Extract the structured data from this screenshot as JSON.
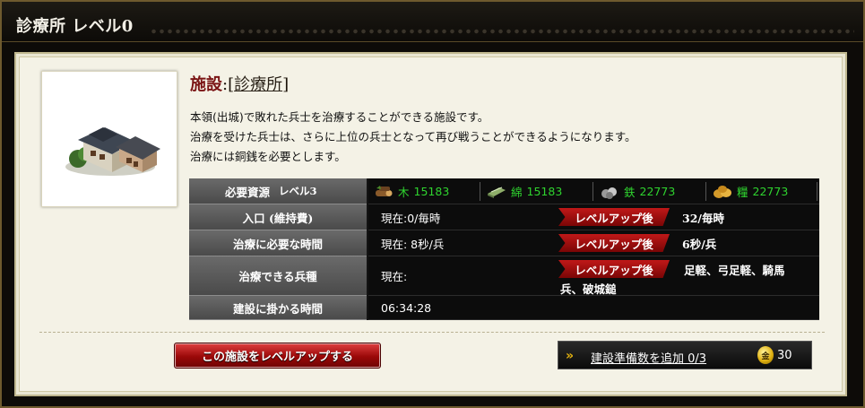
{
  "header": {
    "title": "診療所 レベル0"
  },
  "facility": {
    "label": "施設",
    "colon_open": ":[",
    "name": "診療所",
    "close": "]",
    "description": [
      "本領(出城)で敗れた兵士を治療することができる施設です。",
      "治療を受けた兵士は、さらに上位の兵士となって再び戦うことができるようになります。",
      "治療には銅銭を必要とします。"
    ]
  },
  "table": {
    "resources": {
      "label": "必要資源",
      "level": "レベル3",
      "items": [
        {
          "icon": "wood-icon",
          "name": "木",
          "value": "15183"
        },
        {
          "icon": "cotton-icon",
          "name": "綿",
          "value": "15183"
        },
        {
          "icon": "iron-icon",
          "name": "鉄",
          "value": "22773"
        },
        {
          "icon": "food-icon",
          "name": "糧",
          "value": "22773"
        }
      ]
    },
    "population": {
      "label": "入口 (維持費)",
      "current": "現在:0/毎時",
      "after_label": "レベルアップ後",
      "after": "32/毎時"
    },
    "heal_time": {
      "label": "治療に必要な時間",
      "current": "現在: 8秒/兵",
      "after_label": "レベルアップ後",
      "after": "6秒/兵"
    },
    "troops": {
      "label": "治療できる兵種",
      "current": "現在:",
      "after_label": "レベルアップ後",
      "after_line1": "足軽、弓足軽、騎馬",
      "after_line2": "兵、破城鎚"
    },
    "build_time": {
      "label": "建設に掛かる時間",
      "value": "06:34:28"
    }
  },
  "actions": {
    "level_up": "この施設をレベルアップする",
    "queue": "建設準備数を追加 0/3",
    "coin_symbol": "金",
    "coin_cost": "30"
  },
  "colors": {
    "accent_red": "#a00c0c",
    "resource_green": "#2fd32f",
    "panel_bg": "#f4f2e6"
  }
}
